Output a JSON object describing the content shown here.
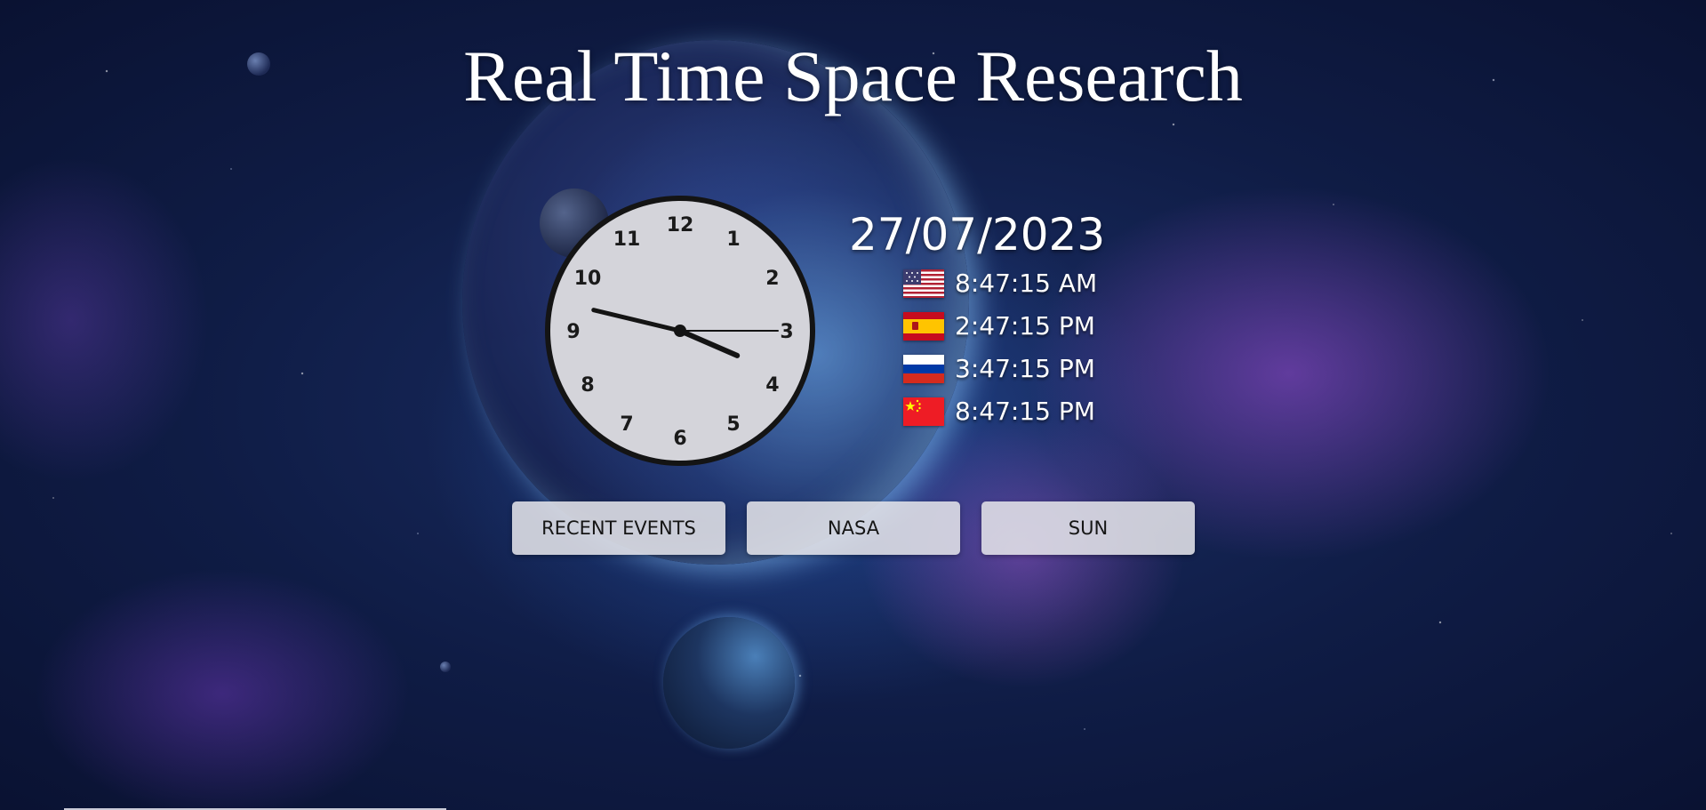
{
  "page": {
    "title": "Real Time Space Research"
  },
  "clock": {
    "numbers": [
      "12",
      "1",
      "2",
      "3",
      "4",
      "5",
      "6",
      "7",
      "8",
      "9",
      "10",
      "11"
    ],
    "hour": 3,
    "minute": 47,
    "second": 15
  },
  "date": "27/07/2023",
  "timezones": [
    {
      "flag": "usa-flag-icon",
      "time": "8:47:15 AM"
    },
    {
      "flag": "spain-flag-icon",
      "time": "2:47:15 PM"
    },
    {
      "flag": "russia-flag-icon",
      "time": "3:47:15 PM"
    },
    {
      "flag": "china-flag-icon",
      "time": "8:47:15 PM"
    }
  ],
  "nav": {
    "recent_events_label": "RECENT EVENTS",
    "nasa_label": "NASA",
    "sun_label": "SUN"
  },
  "colors": {
    "title": "#ffffff",
    "clock_face": "#d4d4da",
    "clock_border": "#141414",
    "button_bg": "#e2e2e8"
  }
}
